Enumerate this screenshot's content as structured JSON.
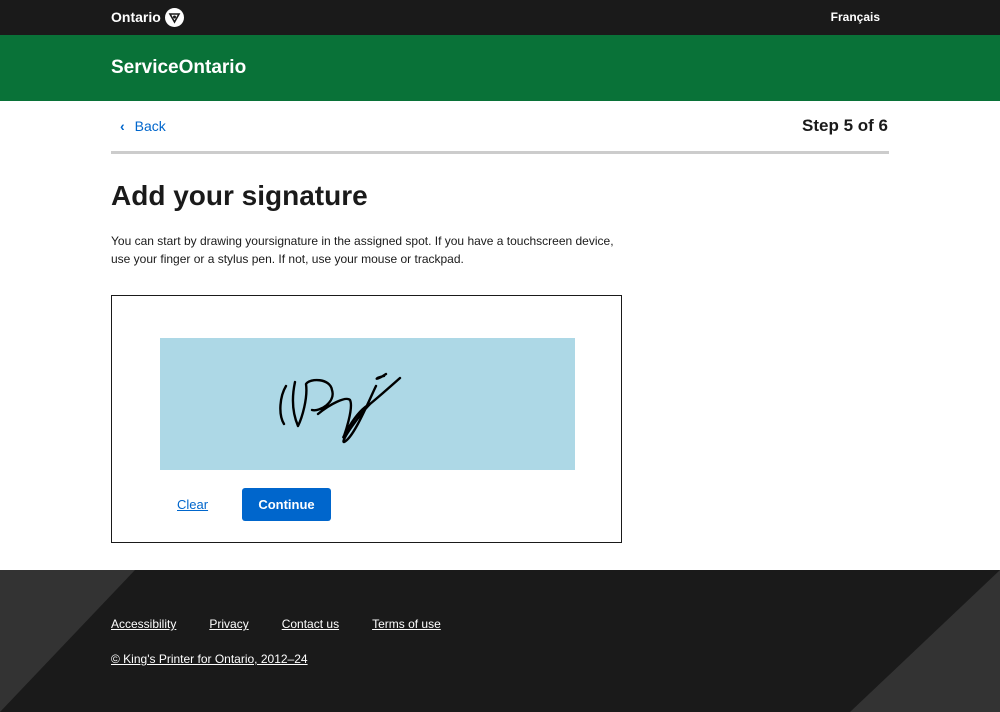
{
  "header": {
    "logo_text": "Ontario",
    "language_link": "Français"
  },
  "brand": {
    "title": "ServiceOntario"
  },
  "nav": {
    "back_label": "Back",
    "step": "Step 5 of 6"
  },
  "main": {
    "title": "Add your signature",
    "intro": "You can start by drawing yoursignature in the assigned spot. If you have a touchscreen device, use your finger or a stylus pen. If not, use your mouse or trackpad."
  },
  "signature": {
    "clear_label": "Clear",
    "continue_label": "Continue",
    "pad_color": "#add8e6"
  },
  "footer": {
    "links": [
      "Accessibility",
      "Privacy",
      "Contact us",
      "Terms of use"
    ],
    "copyright": "© King's Printer for Ontario, 2012–24"
  },
  "colors": {
    "topbar": "#1a1a1a",
    "brand_green": "#097238",
    "link_blue": "#0066cc"
  },
  "icons": {
    "back": "chevron-left-icon",
    "logo": "trillium-icon"
  }
}
